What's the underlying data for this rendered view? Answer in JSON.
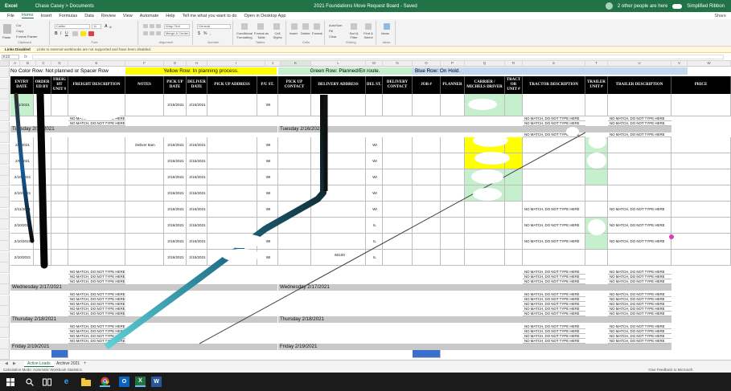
{
  "titlebar": {
    "app": "Excel",
    "user": "Chase Casey > Documents",
    "document": "2021 Foundations Move Request Board - Saved",
    "people": "2 other people are here",
    "simplified": "Simplified Ribbon"
  },
  "menu": [
    "File",
    "Home",
    "Insert",
    "Formulas",
    "Data",
    "Review",
    "View",
    "Automate",
    "Help",
    "Tell me what you want to do",
    "Open in Desktop App"
  ],
  "menu_active": "Home",
  "menu_share": "Share",
  "ribbon": {
    "paste": "Paste",
    "cut": "Cut",
    "copy": "Copy",
    "format_painter": "Format Painter",
    "font": "Calibri",
    "font_size": "11",
    "wrap_text": "Wrap Text",
    "merge": "Merge & Center",
    "number_format": "General",
    "conditional": "Conditional Formatting",
    "format_table": "Format as Table",
    "cell_styles": "Cell Styles",
    "insert": "Insert",
    "delete": "Delete",
    "format": "Format",
    "autosum": "AutoSum",
    "fill": "Fill",
    "clear": "Clear",
    "sort": "Sort & Filter",
    "find": "Find & Select",
    "ideas": "Ideas",
    "groups": [
      "Clipboard",
      "Font",
      "Alignment",
      "Number",
      "Tables",
      "Cells",
      "Editing",
      "Ideas"
    ]
  },
  "infobar": {
    "title": "Links Disabled",
    "message": "Links to external workbooks are not supported and have been disabled."
  },
  "formula": {
    "namebox": "K13",
    "fx": "fx"
  },
  "columns": [
    "A",
    "B",
    "C",
    "D",
    "E",
    "F",
    "G",
    "H",
    "I",
    "J",
    "K",
    "L",
    "M",
    "N",
    "O",
    "P",
    "Q",
    "R",
    "S",
    "T",
    "U",
    "V",
    "W",
    "X"
  ],
  "selected_column": "K",
  "legend": {
    "none": "No Color Row: Not planned or Spacer Row",
    "yellow": "Yellow Row: In planning process.",
    "green": "Green Row: Planned/En route.",
    "blue": "Blue Row: On Hold."
  },
  "headers": [
    "ENTRY DATE",
    "ORDER ED BY",
    "FREIG HT UNIT #",
    "FREIGHT DESCRIPTION",
    "NOTES",
    "PICK UP DATE",
    "DELIVER DATE",
    "PICK UP ADDRESS",
    "P/U ST.",
    "PICK UP CONTACT",
    "DELIVERY ADDRESS",
    "DEL ST.",
    "DELIVERY CONTACT",
    "JOB #",
    "PLANNER",
    "CARRIER / MICHELS DRIVER",
    "TRACT OR UNIT #",
    "TRACTOR DESCRIPTION",
    "TRAILER UNIT #",
    "TRAILER DESCRIPTION",
    "PRICE"
  ],
  "no_match": "NO MATCH, DO NOT TYPE HERE",
  "days": {
    "tuesday": "Tuesday 2/16/2021",
    "wednesday": "Wednesday 2/17/2021",
    "thursday": "Thursday 2/18/2021",
    "friday": "Friday 2/19/2021"
  },
  "rows": [
    {
      "num": "7",
      "entry": "2/1/2021",
      "notes": "",
      "pu": "2/15/2021",
      "del": "2/15/2021",
      "pust": "WI",
      "delst": ""
    },
    {
      "num": "10",
      "entry": "2/5/2021",
      "notes": "Deliver 8am",
      "pu": "2/16/2021",
      "del": "2/16/2021",
      "pust": "WI",
      "delst": "WI"
    },
    {
      "num": "11",
      "entry": "2/6/2021",
      "notes": "",
      "pu": "2/16/2021",
      "del": "2/16/2021",
      "pust": "WI",
      "delst": "WI"
    },
    {
      "num": "12",
      "entry": "2/10/2021",
      "notes": "",
      "pu": "2/16/2021",
      "del": "2/16/2021",
      "pust": "WI",
      "delst": "WI"
    },
    {
      "num": "13",
      "entry": "2/10/2021",
      "notes": "",
      "pu": "2/16/2021",
      "del": "2/16/2021",
      "pust": "WI",
      "delst": "WI"
    },
    {
      "num": "14",
      "entry": "2/11/2021",
      "notes": "",
      "pu": "2/16/2021",
      "del": "2/16/2021",
      "pust": "WI",
      "delst": "WI"
    },
    {
      "num": "15",
      "entry": "2/10/2021",
      "notes": "",
      "pu": "2/16/2021",
      "del": "2/16/2021",
      "pust": "WI",
      "delst": "IL"
    },
    {
      "num": "16",
      "entry": "2/10/2021",
      "notes": "",
      "pu": "2/16/2021",
      "del": "2/16/2021",
      "pust": "WI",
      "delst": "IL"
    },
    {
      "num": "17",
      "entry": "2/10/2021",
      "notes": "",
      "pu": "2/16/2021",
      "del": "2/15/2021",
      "pust": "WI",
      "delst": "IL"
    }
  ],
  "zip_fragment": "60100",
  "sheets": [
    "Active Loads",
    "Archive 2021"
  ],
  "sheet_add": "+",
  "status": {
    "left": "Calculation Mode: Automatic    Workbook Statistics",
    "right": "Give Feedback to Microsoft"
  },
  "clock": {
    "time": "",
    "date": ""
  },
  "colors": {
    "excel_green": "#217346",
    "yellow": "#ffff00",
    "light_green": "#c6efce",
    "blue_hold": "#c5d9f1",
    "blue_cell": "#3a6fd0",
    "day_gray": "#c9c9c9",
    "header_black": "#000000"
  },
  "taskbar_icons": [
    "windows-icon",
    "search-icon",
    "task-view-icon",
    "edge-icon",
    "explorer-icon",
    "chrome-icon",
    "outlook-icon",
    "excel-icon",
    "word-icon"
  ]
}
